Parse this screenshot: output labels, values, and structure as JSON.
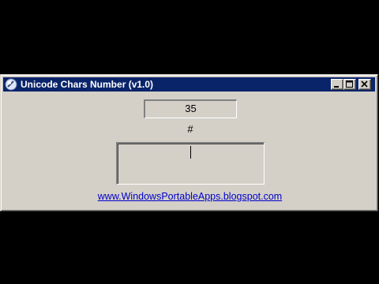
{
  "window": {
    "title": "Unicode Chars Number (v1.0)",
    "icon": "app-icon",
    "controls": [
      "minimize-icon",
      "maximize-icon",
      "close-icon"
    ]
  },
  "main": {
    "number_value": "35",
    "symbol_label": "#",
    "char_input_value": "",
    "link_text": "www.WindowsPortableApps.blogspot.com"
  },
  "colors": {
    "titlebar": "#0a246a",
    "window_bg": "#d4d0c8",
    "link": "#0000cc",
    "background": "#000000"
  }
}
